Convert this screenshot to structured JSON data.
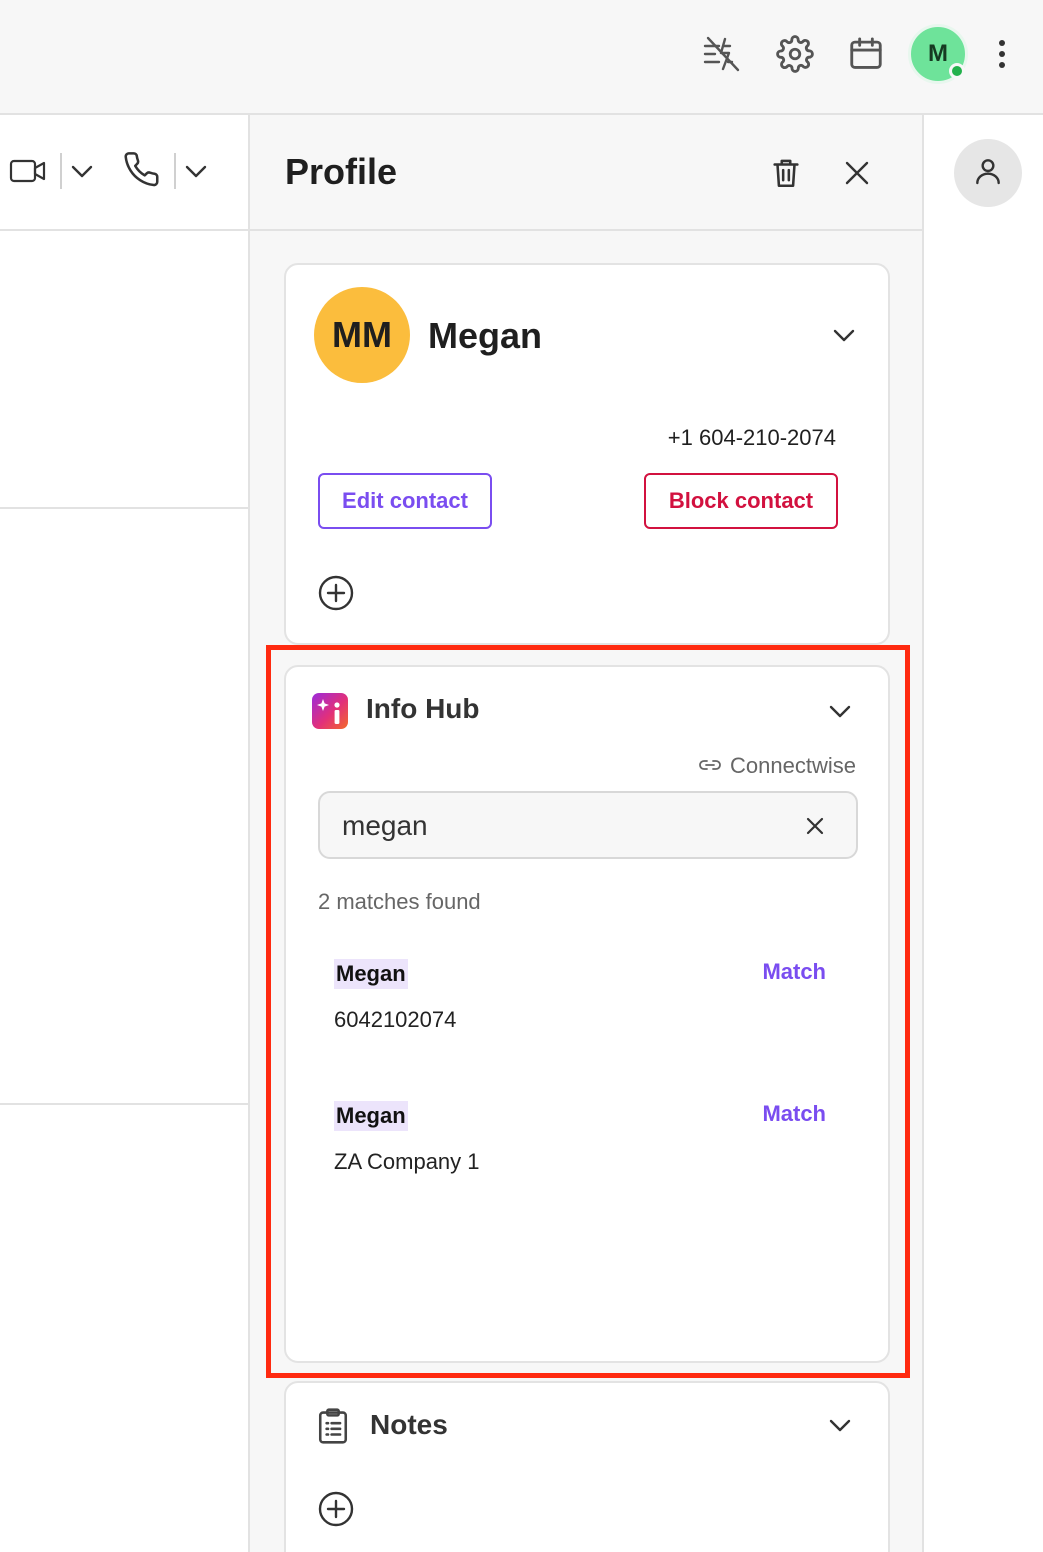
{
  "topbar": {
    "avatar_initial": "M",
    "avatar_color": "#6ee39a",
    "status_color": "#22b14c",
    "icons": [
      "no-signal-icon",
      "gear-icon",
      "calendar-icon",
      "more-vertical-icon"
    ]
  },
  "chat_header": {
    "icons": [
      "video-icon",
      "chevron-down-icon",
      "phone-icon",
      "chevron-down-icon"
    ]
  },
  "profile": {
    "title": "Profile",
    "contact": {
      "initials": "MM",
      "name": "Megan",
      "phone": "+1 604-210-2074",
      "edit_label": "Edit contact",
      "block_label": "Block contact",
      "avatar_color": "#fbbd3d"
    },
    "info_hub": {
      "title": "Info Hub",
      "integration": "Connectwise",
      "search_value": "megan",
      "matches_text": "2 matches found",
      "results": [
        {
          "name": "Megan",
          "detail": "6042102074",
          "action": "Match"
        },
        {
          "name": "Megan",
          "detail": "ZA Company 1",
          "action": "Match"
        }
      ]
    },
    "notes": {
      "title": "Notes"
    }
  },
  "colors": {
    "accent": "#7a4df0",
    "danger": "#d2113f",
    "highlight_frame": "#ff2a10"
  }
}
